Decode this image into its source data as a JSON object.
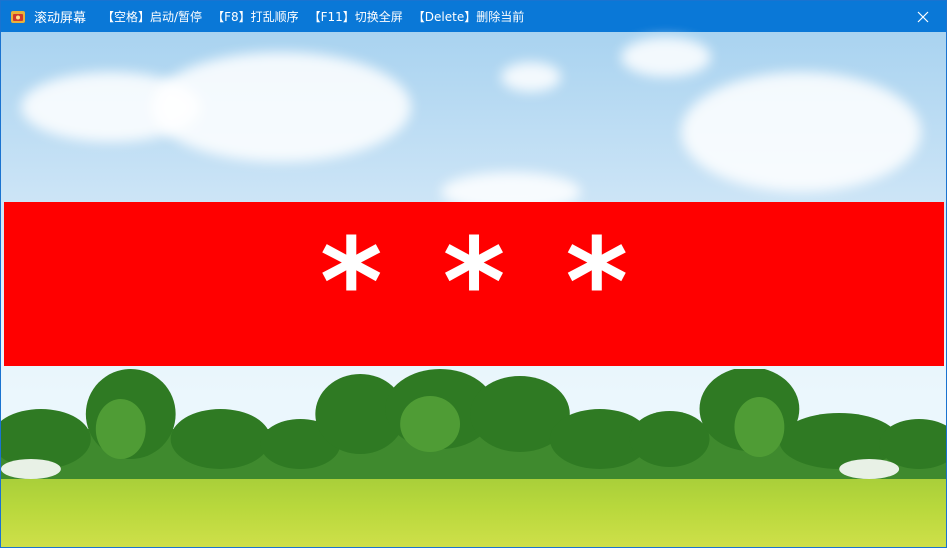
{
  "window": {
    "title": "滚动屏幕",
    "hints": [
      "【空格】启动/暂停",
      "【F8】打乱顺序",
      "【F11】切换全屏",
      "【Delete】删除当前"
    ],
    "close_icon": "close-icon",
    "app_icon": "app-icon"
  },
  "banner": {
    "text": "***",
    "background_color": "#ff0000",
    "text_color": "#ffffff"
  },
  "scene": {
    "description_icon": "landscape-background"
  }
}
